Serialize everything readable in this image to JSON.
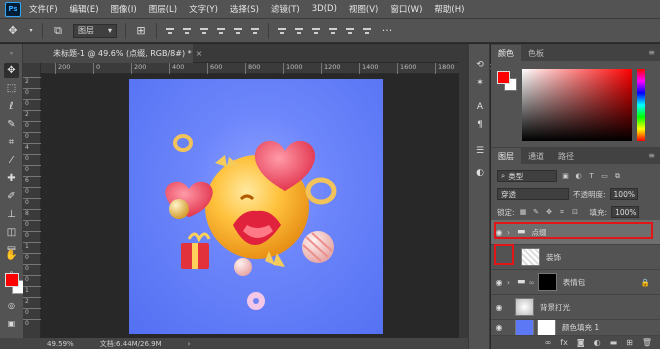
{
  "menubar": {
    "logo": "Ps",
    "items": [
      "文件(F)",
      "编辑(E)",
      "图像(I)",
      "图层(L)",
      "文字(Y)",
      "选择(S)",
      "滤镜(T)",
      "3D(D)",
      "视图(V)",
      "窗口(W)",
      "帮助(H)"
    ]
  },
  "options": {
    "layer_select": "图层",
    "layer_select_arrow": "▾"
  },
  "document": {
    "tab_title": "未标题-1 @ 49.6% (点缀, RGB/8#) *",
    "close": "×"
  },
  "rulers": {
    "top": [
      "200",
      "0",
      "200",
      "400",
      "600",
      "800",
      "1000",
      "1200",
      "1400",
      "1600",
      "1800",
      "2000"
    ],
    "left": [
      "2",
      "0",
      "0",
      "2",
      "0",
      "0",
      "4",
      "0",
      "0",
      "6",
      "0",
      "0",
      "8",
      "0",
      "0",
      "1",
      "0",
      "0",
      "0",
      "1",
      "2",
      "0",
      "0"
    ]
  },
  "status": {
    "zoom": "49.59%",
    "doc_info": "文档:6.44M/26.9M",
    "arrow": "›"
  },
  "color_panel": {
    "tabs": [
      "颜色",
      "色板"
    ],
    "foreground": "#ff0000",
    "background": "#ffffff"
  },
  "layers_panel": {
    "tabs": [
      "图层",
      "通道",
      "路径"
    ],
    "kind_filter": "类型",
    "blend_mode": "穿透",
    "opacity_label": "不透明度:",
    "opacity_value": "100%",
    "lock_label": "锁定:",
    "fill_label": "填充:",
    "fill_value": "100%",
    "layers": [
      {
        "name": "点缀",
        "type": "group",
        "visible": true,
        "selected": true
      },
      {
        "name": "装饰",
        "type": "smart",
        "visible": false,
        "selected": false
      },
      {
        "name": "表情包",
        "type": "group-mask",
        "visible": true,
        "selected": false
      },
      {
        "name": "背景打光",
        "type": "pixel",
        "visible": true,
        "selected": false
      },
      {
        "name": "颜色填充 1",
        "type": "fill",
        "visible": true,
        "selected": false
      }
    ]
  },
  "colors": {
    "accent_highlight": "#e21616",
    "canvas_bg": "#5d78f5"
  }
}
